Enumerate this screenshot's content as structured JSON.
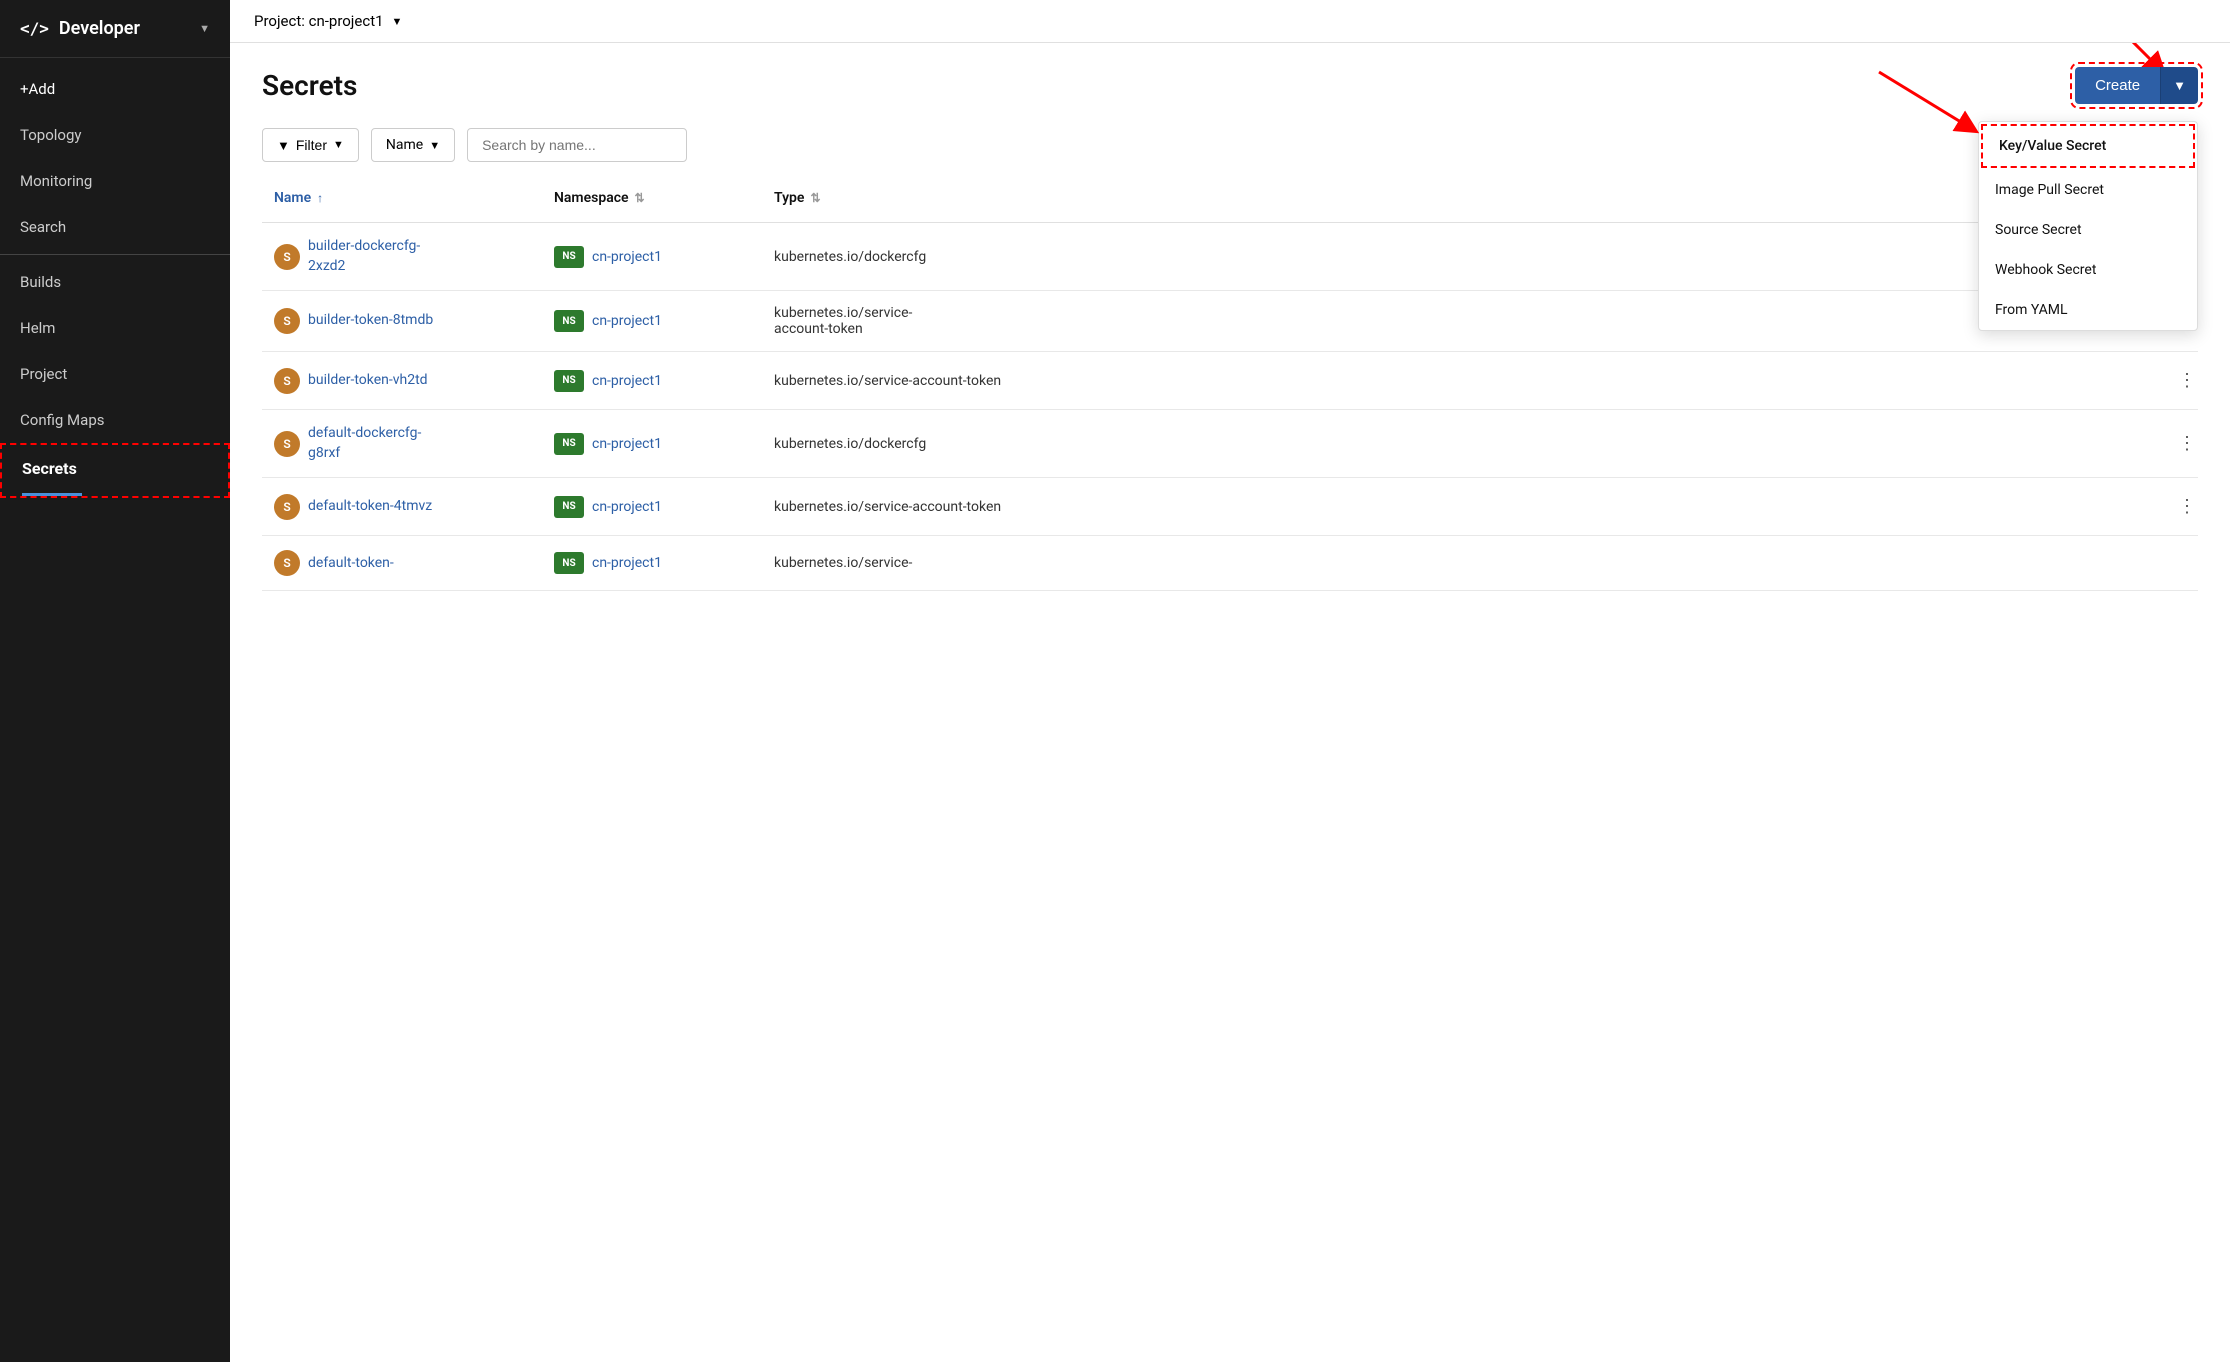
{
  "sidebar": {
    "title": "Developer",
    "arrow": "▼",
    "code_symbol": "</>",
    "items": [
      {
        "label": "+Add",
        "id": "add",
        "active": false
      },
      {
        "label": "Topology",
        "id": "topology",
        "active": false
      },
      {
        "label": "Monitoring",
        "id": "monitoring",
        "active": false
      },
      {
        "label": "Search",
        "id": "search",
        "active": false
      },
      {
        "label": "Builds",
        "id": "builds",
        "active": false
      },
      {
        "label": "Helm",
        "id": "helm",
        "active": false
      },
      {
        "label": "Project",
        "id": "project",
        "active": false
      },
      {
        "label": "Config Maps",
        "id": "configmaps",
        "active": false
      },
      {
        "label": "Secrets",
        "id": "secrets",
        "active": true
      }
    ]
  },
  "topbar": {
    "project_label": "Project: cn-project1",
    "project_arrow": "▼"
  },
  "page": {
    "title": "Secrets"
  },
  "toolbar": {
    "create_label": "Create",
    "create_arrow": "▼",
    "filter_label": "Filter",
    "name_label": "Name",
    "search_placeholder": "Search by name...",
    "filter_arrow": "▼",
    "name_arrow": "▼"
  },
  "table": {
    "columns": [
      {
        "label": "Name",
        "sortable": true,
        "sort_asc": true,
        "id": "name"
      },
      {
        "label": "Namespace",
        "sortable": true,
        "id": "namespace"
      },
      {
        "label": "Type",
        "sortable": false,
        "id": "type"
      },
      {
        "label": "",
        "id": "actions"
      }
    ],
    "rows": [
      {
        "icon": "S",
        "name": "builder-dockercfg-2xzd2",
        "namespace_badge": "NS",
        "namespace": "cn-project1",
        "type": "kubernetes.io/dockercfg",
        "show_kebab": false
      },
      {
        "icon": "S",
        "name": "builder-token-8tmdb",
        "namespace_badge": "NS",
        "namespace": "cn-project1",
        "type": "kubernetes.io/service-account-token",
        "show_kebab": true
      },
      {
        "icon": "S",
        "name": "builder-token-vh2td",
        "namespace_badge": "NS",
        "namespace": "cn-project1",
        "type": "kubernetes.io/service-account-token",
        "show_kebab": true
      },
      {
        "icon": "S",
        "name": "default-dockercfg-g8rxf",
        "namespace_badge": "NS",
        "namespace": "cn-project1",
        "type": "kubernetes.io/dockercfg",
        "show_kebab": true
      },
      {
        "icon": "S",
        "name": "default-token-4tmvz",
        "namespace_badge": "NS",
        "namespace": "cn-project1",
        "type": "kubernetes.io/service-account-token",
        "show_kebab": true
      },
      {
        "icon": "S",
        "name": "default-token-",
        "namespace_badge": "NS",
        "namespace": "cn-project1",
        "type": "kubernetes.io/service-",
        "show_kebab": false
      }
    ]
  },
  "dropdown": {
    "items": [
      {
        "label": "Key/Value Secret",
        "id": "keyvalue",
        "highlighted": true
      },
      {
        "label": "Image Pull Secret",
        "id": "imagepull"
      },
      {
        "label": "Source Secret",
        "id": "source"
      },
      {
        "label": "Webhook Secret",
        "id": "webhook"
      },
      {
        "label": "From YAML",
        "id": "fromyaml"
      }
    ]
  },
  "colors": {
    "sidebar_bg": "#1a1a1a",
    "active_blue": "#2d5fa6",
    "create_btn": "#2d5fa6",
    "secret_badge": "#c17a2a",
    "ns_badge": "#2d7a2d",
    "accent_underline": "#4a90d9"
  }
}
